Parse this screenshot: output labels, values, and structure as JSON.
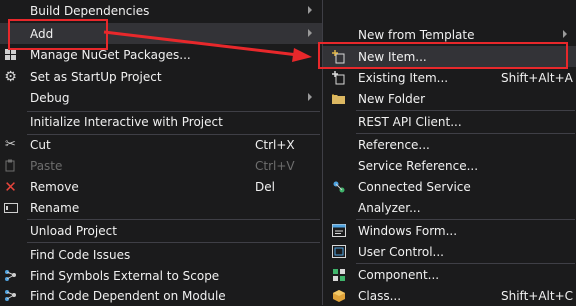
{
  "left_menu": {
    "build_dependencies": "Build Dependencies",
    "add": "Add",
    "manage_nuget": "Manage NuGet Packages...",
    "set_startup": "Set as StartUp Project",
    "debug": "Debug",
    "init_interactive": "Initialize Interactive with Project",
    "cut": "Cut",
    "cut_shortcut": "Ctrl+X",
    "paste": "Paste",
    "paste_shortcut": "Ctrl+V",
    "remove": "Remove",
    "remove_shortcut": "Del",
    "rename": "Rename",
    "unload_project": "Unload Project",
    "find_code_issues": "Find Code Issues",
    "find_symbols_external": "Find Symbols External to Scope",
    "find_code_dependent": "Find Code Dependent on Module"
  },
  "sub_menu": {
    "new_from_template": "New from Template",
    "new_item": "New Item...",
    "existing_item": "Existing Item...",
    "existing_item_shortcut": "Shift+Alt+A",
    "new_folder": "New Folder",
    "rest_api_client": "REST API Client...",
    "reference": "Reference...",
    "service_reference": "Service Reference...",
    "connected_service": "Connected Service",
    "analyzer": "Analyzer...",
    "windows_form": "Windows Form...",
    "user_control": "User Control...",
    "component": "Component...",
    "class": "Class...",
    "class_shortcut": "Shift+Alt+C"
  },
  "colors": {
    "menu_bg": "#1b1b1c",
    "highlight_bg": "#333337",
    "annotation_red": "#e8282b",
    "text": "#f1f1f1",
    "disabled_text": "#6d6d6d"
  }
}
